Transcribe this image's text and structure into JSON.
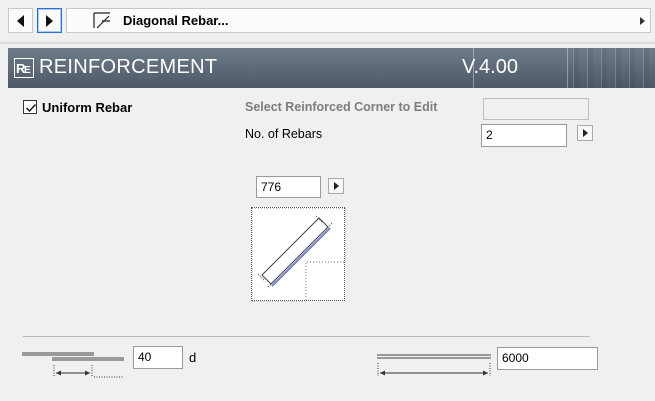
{
  "toolbar": {
    "page_title": "Diagonal Rebar..."
  },
  "banner": {
    "title": "REINFORCEMENT",
    "version": "V.4.00"
  },
  "options": {
    "uniform_rebar_label": "Uniform Rebar",
    "uniform_rebar_checked": true,
    "select_corner_label": "Select Reinforced Corner to Edit",
    "select_corner_value": "",
    "no_of_rebars_label": "No. of Rebars",
    "no_of_rebars_value": "2"
  },
  "preview": {
    "length_value": "776"
  },
  "bottom": {
    "overlap_value": "40",
    "overlap_unit": "d",
    "bar_length_value": "6000"
  },
  "colors": {
    "banner": "#5c6774",
    "rebar_blue": "#7a86c6"
  }
}
